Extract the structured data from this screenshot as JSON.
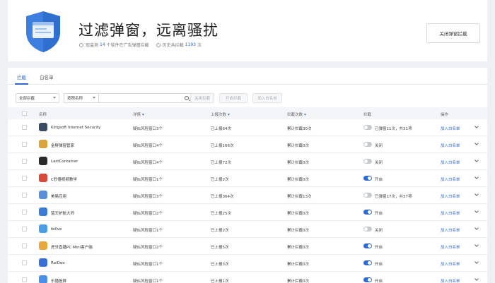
{
  "header": {
    "title": "过滤弹窗，远离骚扰",
    "monitor_prefix": "现监测",
    "monitor_count": "14",
    "monitor_suffix": "个软件在广告弹窗拦截",
    "history_prefix": "历史共拦截",
    "history_count": "1193",
    "history_suffix": "次",
    "close_all_button": "关闭弹窗拦截"
  },
  "tabs": [
    {
      "label": "拦截",
      "active": true
    },
    {
      "label": "白名单",
      "active": false
    }
  ],
  "toolbar": {
    "filter_select": "全部拦截",
    "sort_select": "按照名称",
    "btn_close_intercept": "关闭拦截",
    "btn_open_intercept": "开启拦截",
    "btn_add_whitelist": "加入白名单"
  },
  "table": {
    "columns": [
      "名称",
      "详情",
      "上报次数",
      "拦截次数",
      "拦截",
      "操作"
    ],
    "rows": [
      {
        "name": "Kingsoft Internet Security",
        "detail": "疑似风险窗口3个",
        "reports": "已上报64次",
        "blocks": "累计拦截30次",
        "on": false,
        "status": "已弹窗11次，共31项",
        "action": "加入白名单",
        "icon_color": "#3a4b66"
      },
      {
        "name": "金胖弹窗管家",
        "detail": "疑似风险窗口4个",
        "reports": "已上报166次",
        "blocks": "累计拦截0次",
        "on": false,
        "status": "关闭",
        "action": "加入白名单",
        "icon_color": "#d9a43a"
      },
      {
        "name": "LastContainer",
        "detail": "疑似风险窗口4个",
        "reports": "已上报72次",
        "blocks": "累计拦截0次",
        "on": false,
        "status": "关闭",
        "action": "加入白名单",
        "icon_color": "#2b2b2b"
      },
      {
        "name": "C秒懂视频教学",
        "detail": "疑似风险窗口1个",
        "reports": "已上报2次",
        "blocks": "累计拦截0次",
        "on": true,
        "status": "开启",
        "action": "加入白名单",
        "icon_color": "#d84a3a"
      },
      {
        "name": "美易应用",
        "detail": "疑似风险窗口3个",
        "reports": "已上报364次",
        "blocks": "累计拦截13次",
        "on": false,
        "status": "已弹窗17次，共37项",
        "action": "加入白名单",
        "icon_color": "#5b8fd8"
      },
      {
        "name": "蓝天护航大师",
        "detail": "疑似风险窗口2个",
        "reports": "已上报25次",
        "blocks": "累计拦截0次",
        "on": true,
        "status": "开启",
        "action": "加入白名单",
        "icon_color": "#3a7bd8"
      },
      {
        "name": "tbllve",
        "detail": "疑似风险窗口1个",
        "reports": "已上报2次",
        "blocks": "累计拦截0次",
        "on": false,
        "status": "关闭",
        "action": "加入白名单",
        "icon_color": "#4a9ee8"
      },
      {
        "name": "虎牙直播PC Mini客户端",
        "detail": "疑似风险窗口2个",
        "reports": "已上报5次",
        "blocks": "累计拦截0次",
        "on": true,
        "status": "开启",
        "action": "加入白名单",
        "icon_color": "#e8a93a"
      },
      {
        "name": "RaiDeo",
        "detail": "疑似风险窗口1个",
        "reports": "已上报3次",
        "blocks": "累计拦截0次",
        "on": true,
        "status": "开启",
        "action": "加入白名单",
        "icon_color": "#3a6fd8"
      },
      {
        "name": "乐播投屏",
        "detail": "疑似风险窗口1个",
        "reports": "已上报1次",
        "blocks": "累计拦截0次",
        "on": true,
        "status": "开启",
        "action": "加入白名单",
        "icon_color": "#4a8ee8"
      }
    ]
  }
}
